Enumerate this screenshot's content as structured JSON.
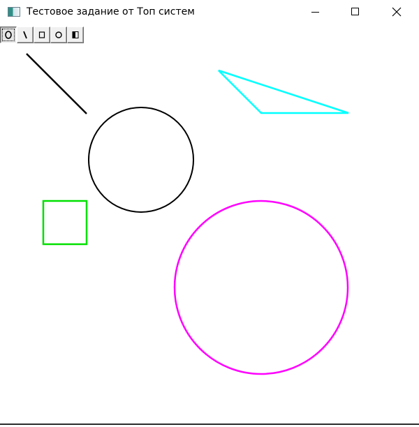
{
  "window": {
    "title": "Тестовое задание от Топ систем",
    "icon": "app-window-icon"
  },
  "title_buttons": [
    {
      "name": "minimize",
      "icon": "minimize-icon"
    },
    {
      "name": "maximize",
      "icon": "maximize-icon"
    },
    {
      "name": "close",
      "icon": "close-icon"
    }
  ],
  "toolbar": {
    "tools": [
      {
        "name": "ellipse",
        "icon": "ellipse-tool-icon",
        "active": true
      },
      {
        "name": "line",
        "icon": "line-tool-icon",
        "active": false
      },
      {
        "name": "rectangle",
        "icon": "rectangle-tool-icon",
        "active": false
      },
      {
        "name": "circle",
        "icon": "circle-tool-icon",
        "active": false
      },
      {
        "name": "fill",
        "icon": "fill-tool-icon",
        "active": false
      }
    ]
  },
  "colors": {
    "line": "#000000",
    "circle_black": "#000000",
    "triangle": "#00ffff",
    "square": "#00e000",
    "circle_magenta": "#ff00ff"
  }
}
